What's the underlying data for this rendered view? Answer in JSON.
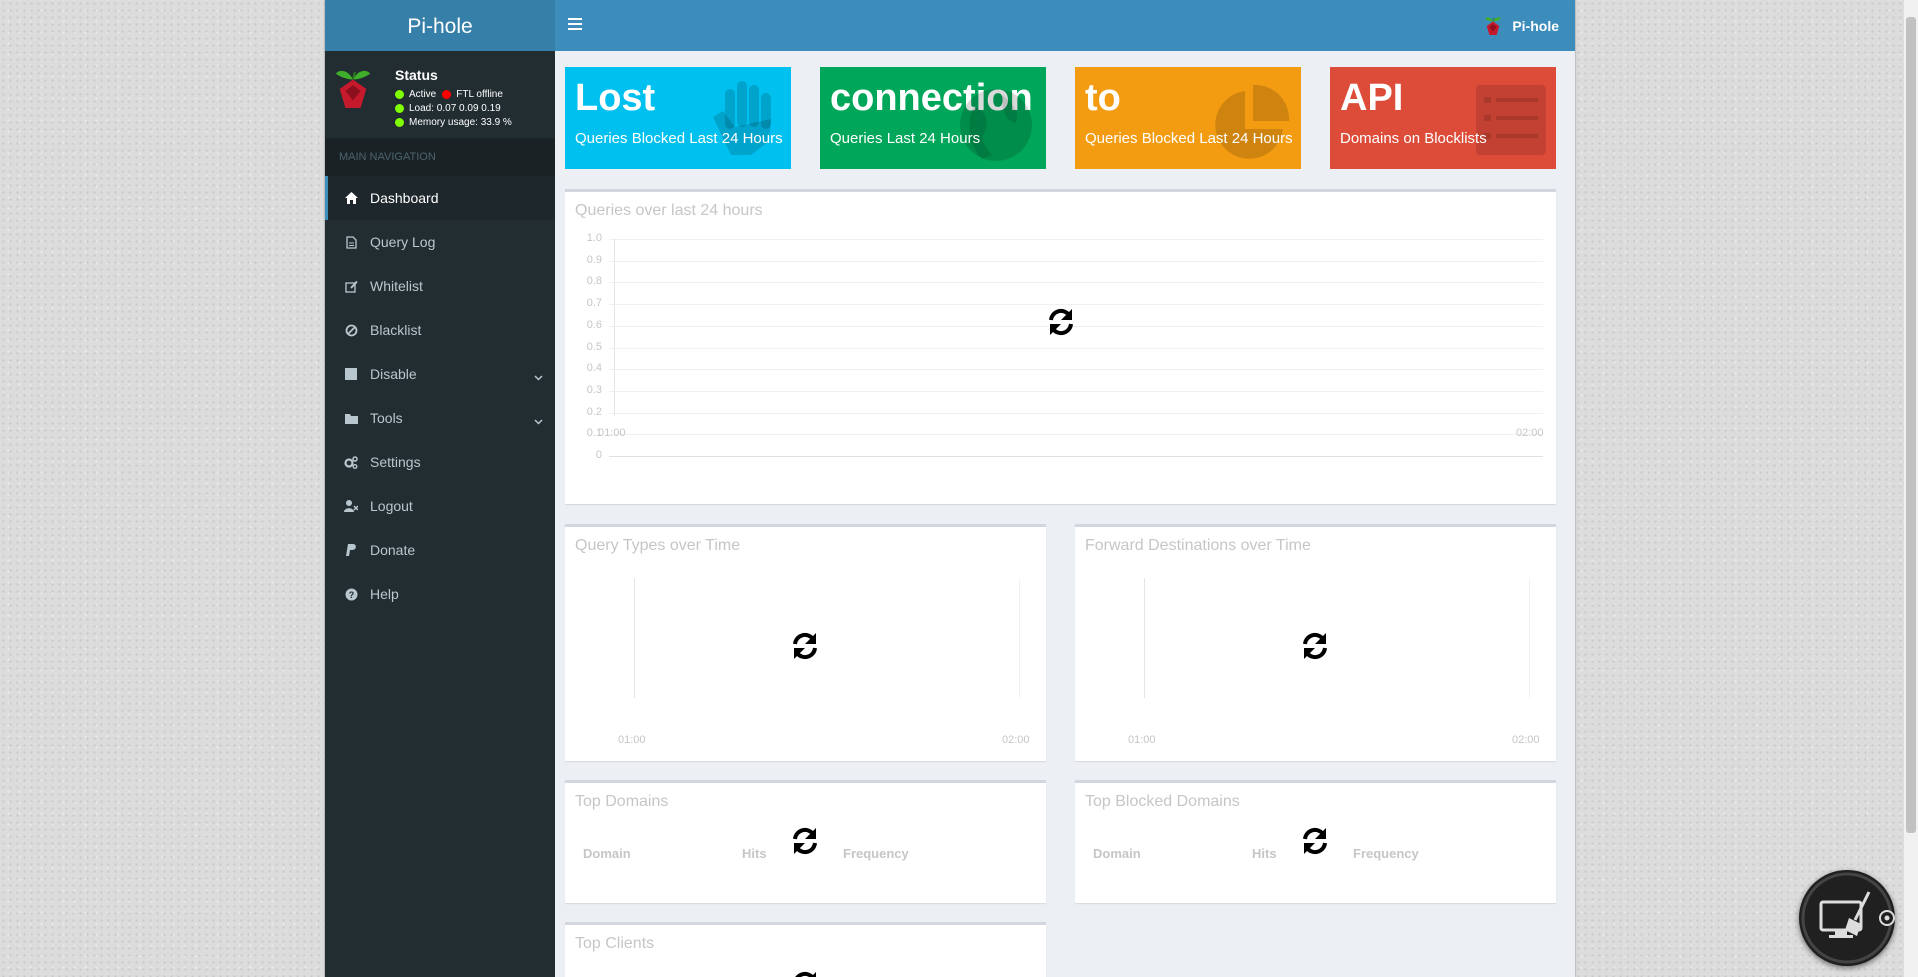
{
  "brand": "Pi-hole",
  "top_user": "Pi-hole",
  "status": {
    "title": "Status",
    "active": "Active",
    "ftl": "FTL offline",
    "load": "Load:  0.07  0.09  0.19",
    "memory": "Memory usage:  33.9 %"
  },
  "nav": {
    "header": "MAIN NAVIGATION",
    "items": [
      {
        "label": "Dashboard",
        "icon": "home-icon"
      },
      {
        "label": "Query Log",
        "icon": "file-icon"
      },
      {
        "label": "Whitelist",
        "icon": "edit-icon"
      },
      {
        "label": "Blacklist",
        "icon": "ban-icon"
      },
      {
        "label": "Disable",
        "icon": "stop-icon"
      },
      {
        "label": "Tools",
        "icon": "folder-icon"
      },
      {
        "label": "Settings",
        "icon": "gears-icon"
      },
      {
        "label": "Logout",
        "icon": "user-times-icon"
      },
      {
        "label": "Donate",
        "icon": "paypal-icon"
      },
      {
        "label": "Help",
        "icon": "question-circle-icon"
      }
    ]
  },
  "stats": [
    {
      "value": "Lost",
      "label": "Queries Blocked Last 24 Hours",
      "color": "#00c0ef",
      "icon": "hand-icon"
    },
    {
      "value": "connection",
      "label": "Queries Last 24 Hours",
      "color": "#00a65a",
      "icon": "globe-icon"
    },
    {
      "value": "to",
      "label": "Queries Blocked Last 24 Hours",
      "color": "#f39c12",
      "icon": "pie-chart-icon"
    },
    {
      "value": "API",
      "label": "Domains on Blocklists",
      "color": "#dd4b39",
      "icon": "list-icon"
    }
  ],
  "queries_chart": {
    "title": "Queries over last 24 hours",
    "y_ticks": [
      "1.0",
      "0.9",
      "0.8",
      "0.7",
      "0.6",
      "0.5",
      "0.4",
      "0.3",
      "0.2",
      "0.1",
      "0"
    ],
    "x_ticks": [
      "01:00",
      "02:00"
    ]
  },
  "query_types": {
    "title": "Query Types over Time",
    "x_ticks": [
      "01:00",
      "02:00"
    ]
  },
  "forward_dest": {
    "title": "Forward Destinations over Time",
    "x_ticks": [
      "01:00",
      "02:00"
    ]
  },
  "top_domains": {
    "title": "Top Domains",
    "cols": [
      "Domain",
      "Hits",
      "Frequency"
    ]
  },
  "top_blocked": {
    "title": "Top Blocked Domains",
    "cols": [
      "Domain",
      "Hits",
      "Frequency"
    ]
  },
  "top_clients": {
    "title": "Top Clients"
  }
}
